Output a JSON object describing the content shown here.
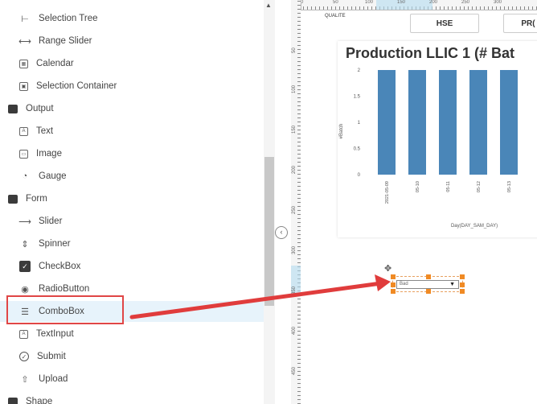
{
  "palette": {
    "items": [
      {
        "label": "Selection Tree",
        "icon": "tree-icon",
        "kind": "sub"
      },
      {
        "label": "Range Slider",
        "icon": "range-slider-icon",
        "kind": "sub"
      },
      {
        "label": "Calendar",
        "icon": "calendar-icon",
        "kind": "sub"
      },
      {
        "label": "Selection Container",
        "icon": "selection-container-icon",
        "kind": "sub"
      },
      {
        "label": "Output",
        "icon": "folder-icon",
        "kind": "group"
      },
      {
        "label": "Text",
        "icon": "text-icon",
        "kind": "sub"
      },
      {
        "label": "Image",
        "icon": "image-icon",
        "kind": "sub"
      },
      {
        "label": "Gauge",
        "icon": "gauge-icon",
        "kind": "sub"
      },
      {
        "label": "Form",
        "icon": "folder-icon",
        "kind": "group"
      },
      {
        "label": "Slider",
        "icon": "slider-icon",
        "kind": "sub"
      },
      {
        "label": "Spinner",
        "icon": "spinner-icon",
        "kind": "sub"
      },
      {
        "label": "CheckBox",
        "icon": "checkbox-icon",
        "kind": "sub"
      },
      {
        "label": "RadioButton",
        "icon": "radio-icon",
        "kind": "sub"
      },
      {
        "label": "ComboBox",
        "icon": "combobox-icon",
        "kind": "sub",
        "highlighted": true
      },
      {
        "label": "TextInput",
        "icon": "text-input-icon",
        "kind": "sub"
      },
      {
        "label": "Submit",
        "icon": "submit-icon",
        "kind": "sub"
      },
      {
        "label": "Upload",
        "icon": "upload-icon",
        "kind": "sub"
      },
      {
        "label": "Shape",
        "icon": "folder-icon",
        "kind": "group"
      }
    ]
  },
  "ruler": {
    "top_labels": [
      "0",
      "50",
      "100",
      "150",
      "200",
      "250",
      "300"
    ],
    "left_labels": [
      "50",
      "100",
      "150",
      "200",
      "250",
      "300",
      "350",
      "400",
      "450"
    ]
  },
  "canvas": {
    "tabs": {
      "quality": "QUALITE",
      "hse": "HSE",
      "pro": "PR("
    },
    "combo_value": "Bad",
    "chart_title": "Production LLIC 1 (# Bat"
  },
  "chart_data": {
    "type": "bar",
    "title": "Production LLIC 1 (# Bat",
    "xlabel": "Day(DAY_SAM_DAY)",
    "ylabel": "#Batch",
    "categories": [
      "2021-05-09",
      "05-10",
      "05-11",
      "05-12",
      "05-13"
    ],
    "values": [
      2,
      2,
      2,
      2,
      2
    ],
    "yticks": [
      "0",
      "0.5",
      "1",
      "1.5",
      "2"
    ],
    "ylim": [
      0,
      2
    ],
    "bar_color": "#4a86b8",
    "grid": false
  },
  "colors": {
    "highlight": "#e04646",
    "arrow": "#e03c3c",
    "selection_handle": "#f08a24"
  }
}
